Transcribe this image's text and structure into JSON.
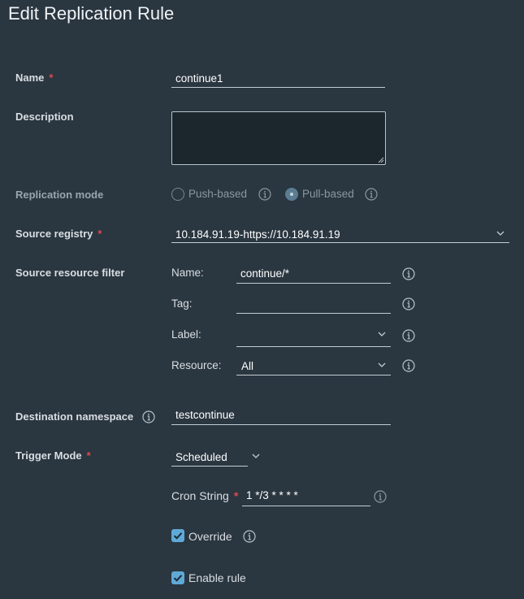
{
  "page": {
    "title": "Edit Replication Rule"
  },
  "name": {
    "label": "Name",
    "value": "continue1"
  },
  "description": {
    "label": "Description",
    "value": ""
  },
  "replication_mode": {
    "label": "Replication mode",
    "options": [
      {
        "label": "Push-based",
        "selected": false
      },
      {
        "label": "Pull-based",
        "selected": true
      }
    ]
  },
  "source_registry": {
    "label": "Source registry",
    "value": "10.184.91.19-https://10.184.91.19"
  },
  "source_filter": {
    "label": "Source resource filter",
    "name_label": "Name:",
    "name_value": "continue/*",
    "tag_label": "Tag:",
    "tag_value": "",
    "label_label": "Label:",
    "label_value": "",
    "resource_label": "Resource:",
    "resource_value": "All"
  },
  "destination_namespace": {
    "label": "Destination namespace",
    "value": "testcontinue"
  },
  "trigger_mode": {
    "label": "Trigger Mode",
    "value": "Scheduled",
    "cron_label": "Cron String",
    "cron_value": "1 */3 * * * *"
  },
  "override": {
    "label": "Override",
    "checked": true
  },
  "enable_rule": {
    "label": "Enable rule",
    "checked": true
  },
  "colors": {
    "background": "#2a3640",
    "required": "#e0484b",
    "checkbox": "#5fa9d6"
  }
}
